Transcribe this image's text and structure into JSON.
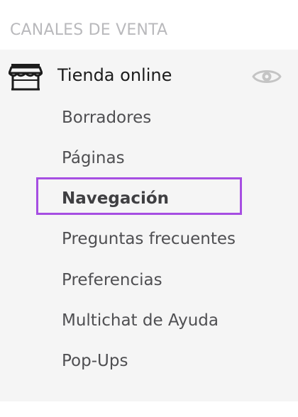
{
  "section": {
    "title": "CANALES DE VENTA"
  },
  "channel": {
    "label": "Tienda online",
    "icon": "storefront-icon",
    "visibility_icon": "eye-icon"
  },
  "menu": {
    "items": [
      {
        "label": "Borradores",
        "active": false
      },
      {
        "label": "Páginas",
        "active": false
      },
      {
        "label": "Navegación",
        "active": true
      },
      {
        "label": "Preguntas frecuentes",
        "active": false
      },
      {
        "label": "Preferencias",
        "active": false
      },
      {
        "label": "Multichat de Ayuda",
        "active": false
      },
      {
        "label": "Pop-Ups",
        "active": false
      }
    ]
  },
  "colors": {
    "panel_background": "#f5f5f5",
    "section_header_text": "#b9b9bc",
    "menu_text": "#4f4f52",
    "highlight_border": "#a64ee2",
    "eye_icon": "#c4c4c4"
  }
}
